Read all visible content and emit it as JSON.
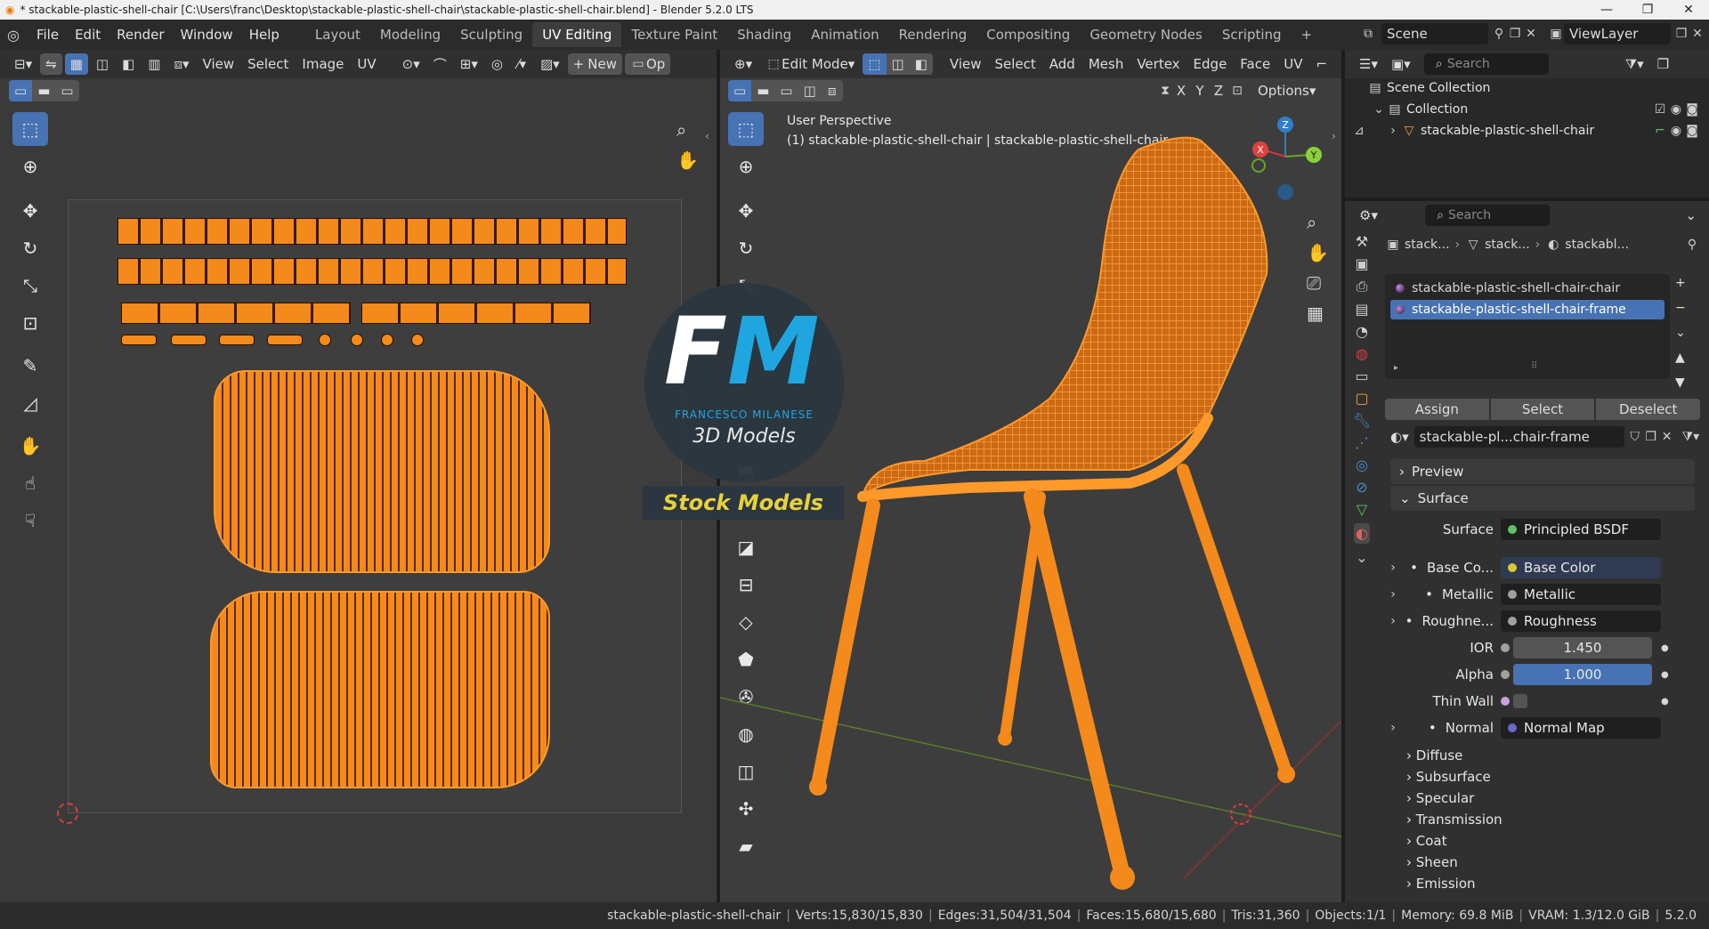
{
  "titlebar": {
    "title": "* stackable-plastic-shell-chair [C:\\Users\\franc\\Desktop\\stackable-plastic-shell-chair\\stackable-plastic-shell-chair.blend] - Blender 5.2.0 LTS",
    "min": "—",
    "max": "❐",
    "close": "✕"
  },
  "menu": [
    "File",
    "Edit",
    "Render",
    "Window",
    "Help"
  ],
  "workspaces": [
    "Layout",
    "Modeling",
    "Sculpting",
    "UV Editing",
    "Texture Paint",
    "Shading",
    "Animation",
    "Rendering",
    "Compositing",
    "Geometry Nodes",
    "Scripting"
  ],
  "active_workspace": "UV Editing",
  "scene": {
    "name": "Scene",
    "viewlayer": "ViewLayer"
  },
  "uv_header": {
    "view": "View",
    "select": "Select",
    "image": "Image",
    "uv": "UV",
    "new": "New",
    "open": "Op"
  },
  "viewport_header": {
    "mode": "Edit Mode",
    "view": "View",
    "select": "Select",
    "add": "Add",
    "mesh": "Mesh",
    "vertex": "Vertex",
    "edge": "Edge",
    "face": "Face",
    "uv": "UV",
    "options": "Options",
    "axes": [
      "X",
      "Y",
      "Z"
    ]
  },
  "viewport": {
    "perspective": "User Perspective",
    "object_info": "(1) stackable-plastic-shell-chair | stackable-plastic-shell-chair",
    "gizmo": {
      "x": "X",
      "y": "Y",
      "z": "Z"
    }
  },
  "watermark": {
    "initials_f": "F",
    "initials_m": "M",
    "name": "FRANCESCO MILANESE",
    "subtitle": "3D Models",
    "banner": "Stock Models"
  },
  "outliner": {
    "search_placeholder": "Search",
    "scene_collection": "Scene Collection",
    "collection": "Collection",
    "object": "stackable-plastic-shell-chair"
  },
  "properties": {
    "search_placeholder": "Search",
    "breadcrumb": [
      "stack...",
      "stack...",
      "stackabl..."
    ],
    "material_slots": [
      "stackable-plastic-shell-chair-chair",
      "stackable-plastic-shell-chair-frame"
    ],
    "buttons": {
      "assign": "Assign",
      "select": "Select",
      "deselect": "Deselect"
    },
    "material_name": "stackable-pl...chair-frame",
    "panels": {
      "preview": "Preview",
      "surface": "Surface"
    },
    "rows": [
      {
        "label": "Surface",
        "value": "Principled BSDF",
        "dot": "#5fc26b"
      },
      {
        "label": "Base Co...",
        "value": "Base Color",
        "dot": "#d8c93a"
      },
      {
        "label": "Metallic",
        "value": "Metallic",
        "dot": "#a0a0a0"
      },
      {
        "label": "Roughne...",
        "value": "Roughness",
        "dot": "#a0a0a0"
      },
      {
        "label": "IOR",
        "value": "1.450",
        "dot": "#a0a0a0"
      },
      {
        "label": "Alpha",
        "value": "1.000",
        "dot": "#a0a0a0"
      },
      {
        "label": "Thin Wall",
        "value": "",
        "dot": "#c9a0dc"
      },
      {
        "label": "Normal",
        "value": "Normal Map",
        "dot": "#6a6acb"
      }
    ],
    "subpanels": [
      "Diffuse",
      "Subsurface",
      "Specular",
      "Transmission",
      "Coat",
      "Sheen",
      "Emission"
    ]
  },
  "status": {
    "object": "stackable-plastic-shell-chair",
    "verts": "Verts:15,830/15,830",
    "edges": "Edges:31,504/31,504",
    "faces": "Faces:15,680/15,680",
    "tris": "Tris:31,360",
    "objects": "Objects:1/1",
    "memory": "Memory: 69.8 MiB",
    "vram": "VRAM: 1.3/12.0 GiB",
    "version": "5.2.0"
  },
  "colors": {
    "accent": "#4772b3",
    "orange": "#f48a1b",
    "panel": "#303030"
  }
}
